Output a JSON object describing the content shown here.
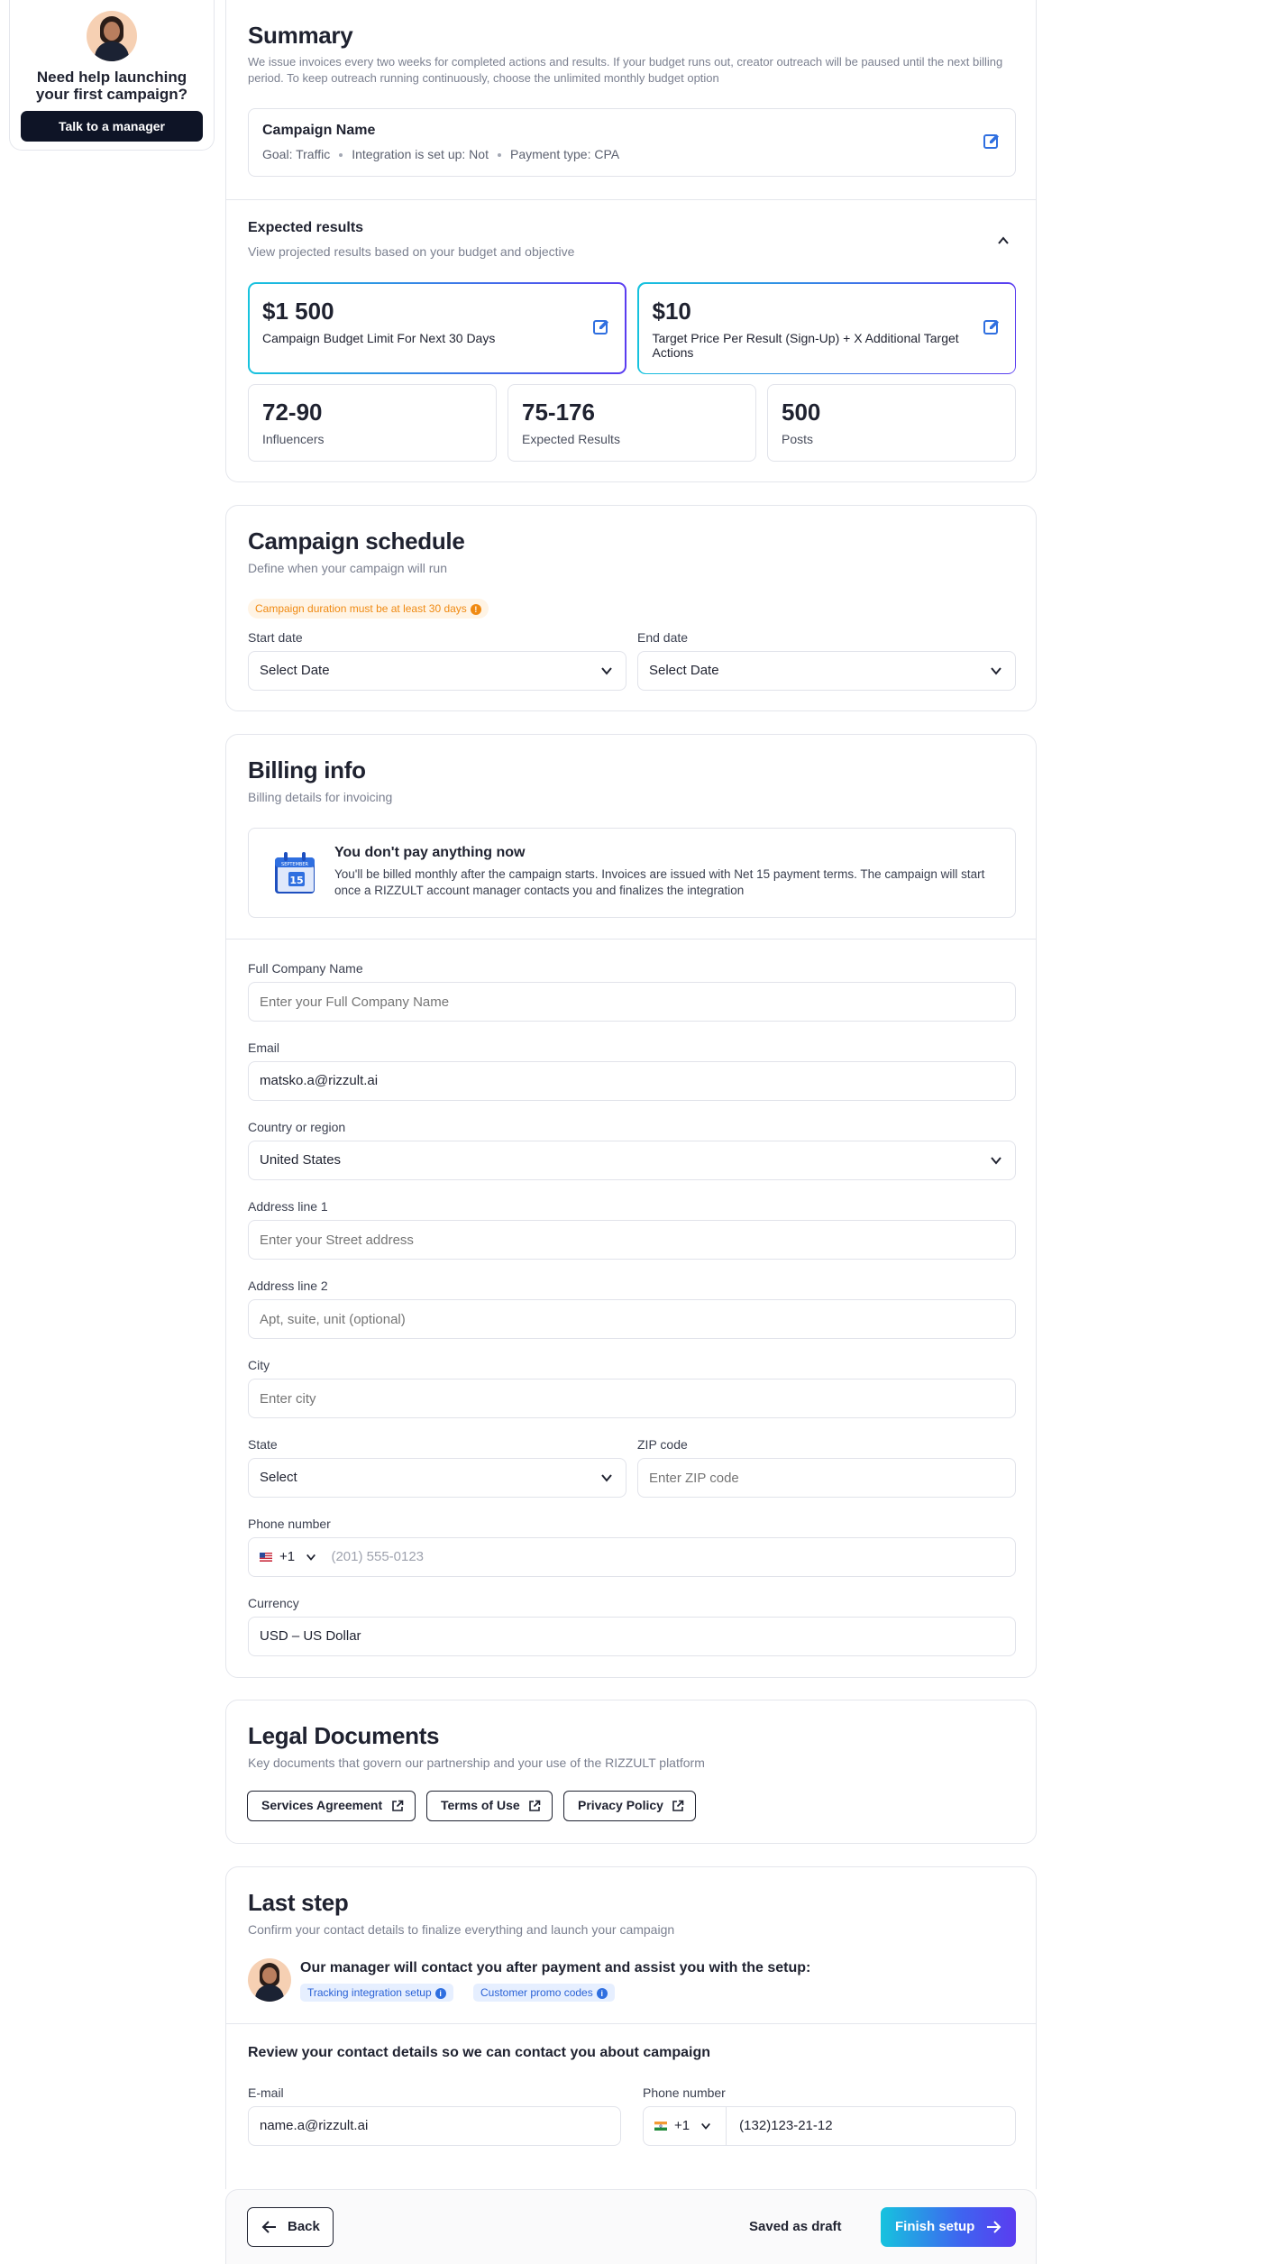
{
  "help": {
    "title": "Need help launching your first campaign?",
    "button": "Talk to a manager"
  },
  "summary": {
    "title": "Summary",
    "description": "We issue invoices every two weeks for completed actions and results. If your budget runs out, creator outreach will be paused until the next billing period. To keep outreach running continuously, choose the unlimited monthly budget option",
    "campaign_name": "Campaign Name",
    "goal": "Goal: Traffic",
    "integration": "Integration is set up: Not",
    "payment_type": "Payment type: CPA"
  },
  "expected": {
    "title": "Expected results",
    "subtitle": "View projected results based on your budget and objective",
    "budget_value": "$1 500",
    "budget_label": "Campaign Budget Limit For Next 30 Days",
    "target_value": "$10",
    "target_label": "Target Price Per Result (Sign-Up) + X Additional Target Actions",
    "stats": [
      {
        "value": "72-90",
        "label": "Influencers"
      },
      {
        "value": "75-176",
        "label": "Expected Results"
      },
      {
        "value": "500",
        "label": "Posts"
      }
    ]
  },
  "schedule": {
    "title": "Campaign schedule",
    "subtitle": "Define when your campaign will run",
    "warning": "Campaign duration must be at least 30 days",
    "start_label": "Start date",
    "start_value": "Select Date",
    "end_label": "End date",
    "end_value": "Select Date"
  },
  "billing": {
    "title": "Billing info",
    "subtitle": "Billing details for invoicing",
    "notice_title": "You don't pay anything now",
    "notice_text": "You'll be billed monthly after the campaign starts. Invoices are issued with Net 15 payment terms. The campaign will start once a RIZZULT account manager contacts you and finalizes the integration",
    "calendar_month": "SEPTEMBER",
    "calendar_day": "15",
    "company_label": "Full Company Name",
    "company_placeholder": "Enter your Full Company Name",
    "email_label": "Email",
    "email_value": "matsko.a@rizzult.ai",
    "country_label": "Country or region",
    "country_value": "United States",
    "address1_label": "Address line 1",
    "address1_placeholder": "Enter your Street address",
    "address2_label": "Address line 2",
    "address2_placeholder": "Apt, suite, unit (optional)",
    "city_label": "City",
    "city_placeholder": "Enter city",
    "state_label": "State",
    "state_value": "Select",
    "zip_label": "ZIP code",
    "zip_placeholder": "Enter ZIP code",
    "phone_label": "Phone number",
    "phone_code": "+1",
    "phone_placeholder": "(201) 555-0123",
    "currency_label": "Currency",
    "currency_value": "USD – US Dollar"
  },
  "legal": {
    "title": "Legal Documents",
    "subtitle": "Key documents that govern our partnership and your use of the RIZZULT platform",
    "links": [
      "Services Agreement",
      "Terms of Use",
      "Privacy Policy"
    ]
  },
  "last_step": {
    "title": "Last step",
    "subtitle": "Confirm your contact details to finalize everything and launch your campaign",
    "manager_text": "Our manager will contact you after payment and assist you with the setup:",
    "tags": [
      "Tracking integration setup",
      "Customer promo codes"
    ],
    "review_title": "Review your contact details so we can contact you about campaign",
    "email_label": "E-mail",
    "email_value": "name.a@rizzult.ai",
    "phone_label": "Phone number",
    "phone_code": "+1",
    "phone_value": "(132)123-21-12"
  },
  "footer": {
    "back": "Back",
    "saved": "Saved as draft",
    "finish": "Finish setup"
  },
  "colors": {
    "accent_blue": "#2f6fe0",
    "selected_border_start": "#16c3de",
    "selected_border_end": "#5a3cf0",
    "warning": "#f08a12",
    "dark": "#0e1426"
  }
}
